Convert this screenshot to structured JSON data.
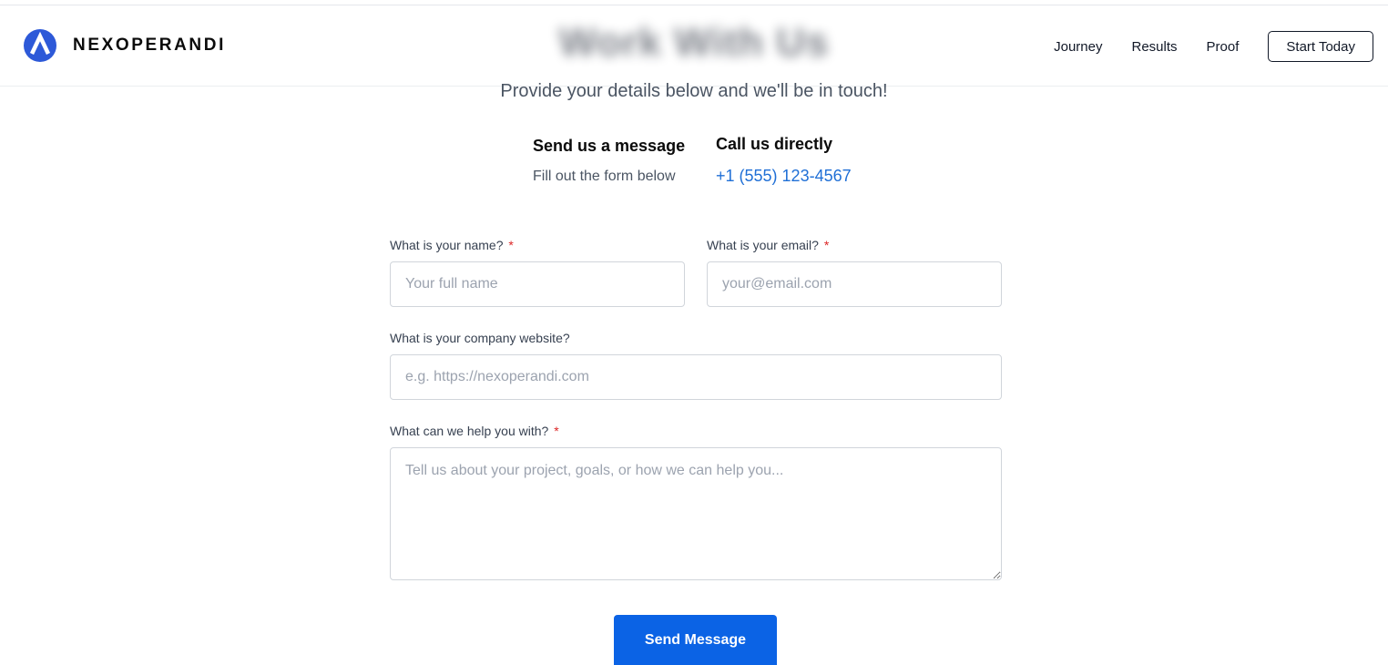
{
  "hero": {
    "title": "Work With Us",
    "subtitle": "Provide your details below and we'll be in touch!"
  },
  "header": {
    "brand": "NEXOPERANDI",
    "nav": [
      "Journey",
      "Results",
      "Proof"
    ],
    "cta": "Start Today"
  },
  "contact": {
    "message_title": "Send us a message",
    "message_sub": "Fill out the form below",
    "call_title": "Call us directly",
    "phone": "+1 (555) 123-4567"
  },
  "form": {
    "name": {
      "label": "What is your name?",
      "required": "*",
      "placeholder": "Your full name",
      "value": ""
    },
    "email": {
      "label": "What is your email?",
      "required": "*",
      "placeholder": "your@email.com",
      "value": ""
    },
    "website": {
      "label": "What is your company website?",
      "placeholder": "e.g. https://nexoperandi.com",
      "value": ""
    },
    "help": {
      "label": "What can we help you with?",
      "required": "*",
      "placeholder": "Tell us about your project, goals, or how we can help you...",
      "value": ""
    },
    "submit": "Send Message"
  },
  "colors": {
    "accent": "#0b63e5",
    "link": "#1f6fd6",
    "required": "#dc2626",
    "logo": "#2d59d8"
  },
  "icons": {
    "logo": "nexoperandi-logo-icon"
  }
}
